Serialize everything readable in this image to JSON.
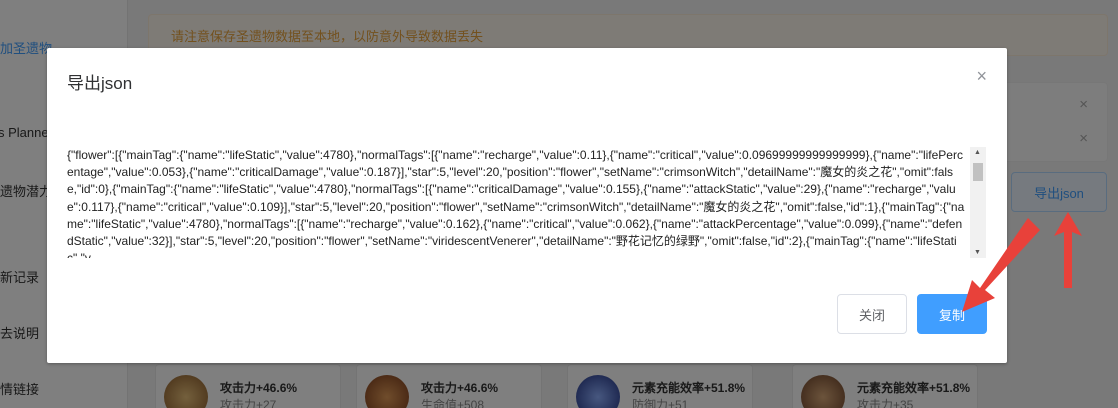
{
  "sidebar": {
    "items": [
      {
        "label": "加圣遗物",
        "active": true
      },
      {
        "label": "s Planne",
        "active": false
      },
      {
        "label": "遗物潜力",
        "active": false
      },
      {
        "label": "新记录",
        "active": false
      },
      {
        "label": "去说明",
        "active": false
      },
      {
        "label": "情链接",
        "active": false
      }
    ]
  },
  "notice": {
    "text": "请注意保存圣遗物数据至本地，以防意外导致数据丢失"
  },
  "row_close_icons": [
    "×",
    "×"
  ],
  "export_button": {
    "label": "导出json"
  },
  "cards": [
    {
      "main_stat": "攻击力+46.6%",
      "sub_stat": "攻击力+27",
      "thumb_color": "#c89a5a"
    },
    {
      "main_stat": "攻击力+46.6%",
      "sub_stat": "生命值+508",
      "thumb_color": "#c47a3c"
    },
    {
      "main_stat": "元素充能效率+51.8%",
      "sub_stat": "防御力+51",
      "thumb_color": "#3a4fa8"
    },
    {
      "main_stat": "元素充能效率+51.8%",
      "sub_stat": "攻击力+35",
      "thumb_color": "#b07848"
    }
  ],
  "dialog": {
    "title": "导出json",
    "close_icon": "×",
    "json_text": "{\"flower\":[{\"mainTag\":{\"name\":\"lifeStatic\",\"value\":4780},\"normalTags\":[{\"name\":\"recharge\",\"value\":0.11},{\"name\":\"critical\",\"value\":0.09699999999999999},{\"name\":\"lifePercentage\",\"value\":0.053},{\"name\":\"criticalDamage\",\"value\":0.187}],\"star\":5,\"level\":20,\"position\":\"flower\",\"setName\":\"crimsonWitch\",\"detailName\":\"魔女的炎之花\",\"omit\":false,\"id\":0},{\"mainTag\":{\"name\":\"lifeStatic\",\"value\":4780},\"normalTags\":[{\"name\":\"criticalDamage\",\"value\":0.155},{\"name\":\"attackStatic\",\"value\":29},{\"name\":\"recharge\",\"value\":0.117},{\"name\":\"critical\",\"value\":0.109}],\"star\":5,\"level\":20,\"position\":\"flower\",\"setName\":\"crimsonWitch\",\"detailName\":\"魔女的炎之花\",\"omit\":false,\"id\":1},{\"mainTag\":{\"name\":\"lifeStatic\",\"value\":4780},\"normalTags\":[{\"name\":\"recharge\",\"value\":0.162},{\"name\":\"critical\",\"value\":0.062},{\"name\":\"attackPercentage\",\"value\":0.099},{\"name\":\"defendStatic\",\"value\":32}],\"star\":5,\"level\":20,\"position\":\"flower\",\"setName\":\"viridescentVenerer\",\"detailName\":\"野花记忆的绿野\",\"omit\":false,\"id\":2},{\"mainTag\":{\"name\":\"lifeStatic\",\"v",
    "close_button": "关闭",
    "copy_button": "复制"
  },
  "colors": {
    "primary": "#409eff",
    "warning": "#e6a23c",
    "annotation": "#e8413a"
  }
}
